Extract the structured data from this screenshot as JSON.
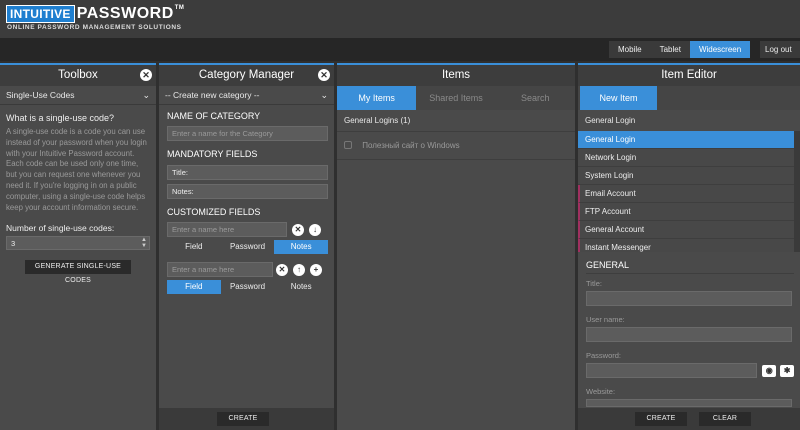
{
  "header": {
    "logo_box": "INTUITIVE",
    "logo_word": "PASSWORD",
    "logo_tm": "TM",
    "logo_sub": "ONLINE PASSWORD MANAGEMENT SOLUTIONS",
    "views": [
      "Mobile",
      "Tablet",
      "Widescreen"
    ],
    "active_view": "Widescreen",
    "logout": "Log out"
  },
  "toolbox": {
    "title": "Toolbox",
    "selected": "Single-Use Codes",
    "question": "What is a single-use code?",
    "description": "A single-use code is a code you can use instead of your password when you login with your Intuitive Password account. Each code can be used only one time, but you can request one whenever you need it. If you're logging in on a public computer, using a single-use code helps keep your account information secure.",
    "count_label": "Number of single-use codes:",
    "count_value": "3",
    "generate_label": "GENERATE SINGLE-USE CODES"
  },
  "category": {
    "title": "Category Manager",
    "selected": "-- Create new category --",
    "name_label": "NAME OF CATEGORY",
    "name_placeholder": "Enter a name for the Category",
    "mandatory_label": "MANDATORY FIELDS",
    "mandatory": [
      "Title:",
      "Notes:"
    ],
    "custom_label": "CUSTOMIZED FIELDS",
    "custom_placeholder": "Enter a name here",
    "types": [
      "Field",
      "Password",
      "Notes"
    ],
    "custom_1_selected": "Notes",
    "custom_2_selected": "Field",
    "create_label": "CREATE"
  },
  "items": {
    "title": "Items",
    "tabs": [
      "My Items",
      "Shared Items",
      "Search"
    ],
    "group": "General Logins (1)",
    "entries": [
      "Полезный сайт о Windows"
    ]
  },
  "editor": {
    "title": "Item Editor",
    "tab": "New Item",
    "selected": "General Login",
    "types": [
      "General Login",
      "Network Login",
      "System Login",
      "Email Account",
      "FTP Account",
      "General Account",
      "Instant Messenger"
    ],
    "section": "GENERAL",
    "fields": [
      "Title:",
      "User name:",
      "Password:",
      "Website:"
    ],
    "create_label": "CREATE",
    "clear_label": "CLEAR"
  }
}
